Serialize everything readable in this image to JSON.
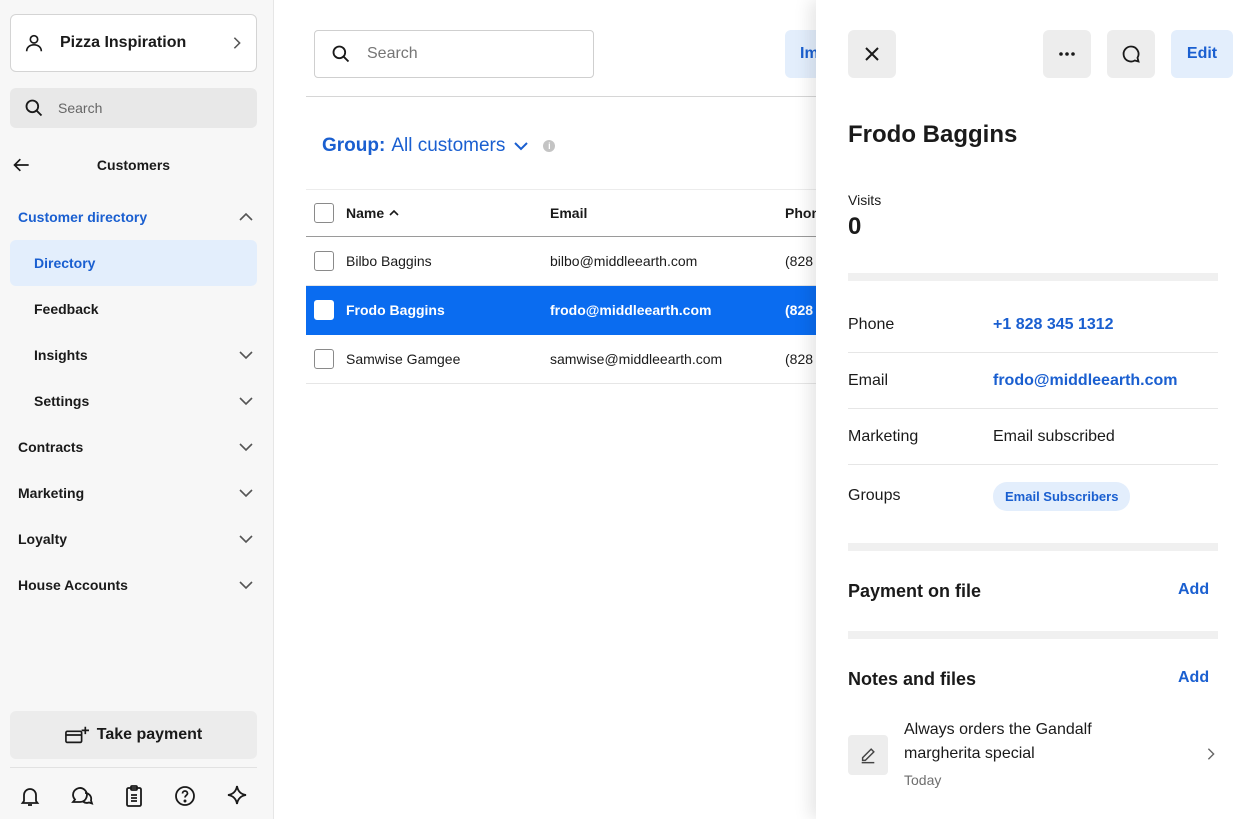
{
  "sidebar": {
    "business_name": "Pizza Inspiration",
    "search_placeholder": "Search",
    "section_title": "Customers",
    "nav": {
      "customer_directory": "Customer directory",
      "directory": "Directory",
      "feedback": "Feedback",
      "insights": "Insights",
      "settings": "Settings",
      "contracts": "Contracts",
      "marketing": "Marketing",
      "loyalty": "Loyalty",
      "house_accounts": "House Accounts"
    },
    "take_payment": "Take payment",
    "bottom_icons": [
      "bell-icon",
      "chat-icon",
      "clipboard-icon",
      "help-icon",
      "sparkle-icon"
    ]
  },
  "main": {
    "search_placeholder": "Search",
    "import_label": "Im",
    "group_label": "Group:",
    "group_value": "All customers",
    "info_glyph": "i",
    "columns": {
      "name": "Name",
      "email": "Email",
      "phone": "Phon"
    },
    "rows": [
      {
        "name": "Bilbo Baggins",
        "email": "bilbo@middleearth.com",
        "phone": "(828"
      },
      {
        "name": "Frodo Baggins",
        "email": "frodo@middleearth.com",
        "phone": "(828"
      },
      {
        "name": "Samwise Gamgee",
        "email": "samwise@middleearth.com",
        "phone": "(828"
      }
    ],
    "selected_row": 1
  },
  "detail": {
    "edit_label": "Edit",
    "name": "Frodo Baggins",
    "visits_label": "Visits",
    "visits_value": "0",
    "phone_label": "Phone",
    "phone_value": "+1 828 345 1312",
    "email_label": "Email",
    "email_value": "frodo@middleearth.com",
    "marketing_label": "Marketing",
    "marketing_value": "Email subscribed",
    "groups_label": "Groups",
    "groups_value": "Email Subscribers",
    "payment_title": "Payment on file",
    "payment_add": "Add",
    "notes_title": "Notes and files",
    "notes_add": "Add",
    "note_text": "Always orders the Gandalf margherita special",
    "note_date": "Today"
  },
  "colors": {
    "accent": "#1a5fd0",
    "selected_row": "#0a6cf0",
    "pill_bg": "#e3eefc"
  }
}
